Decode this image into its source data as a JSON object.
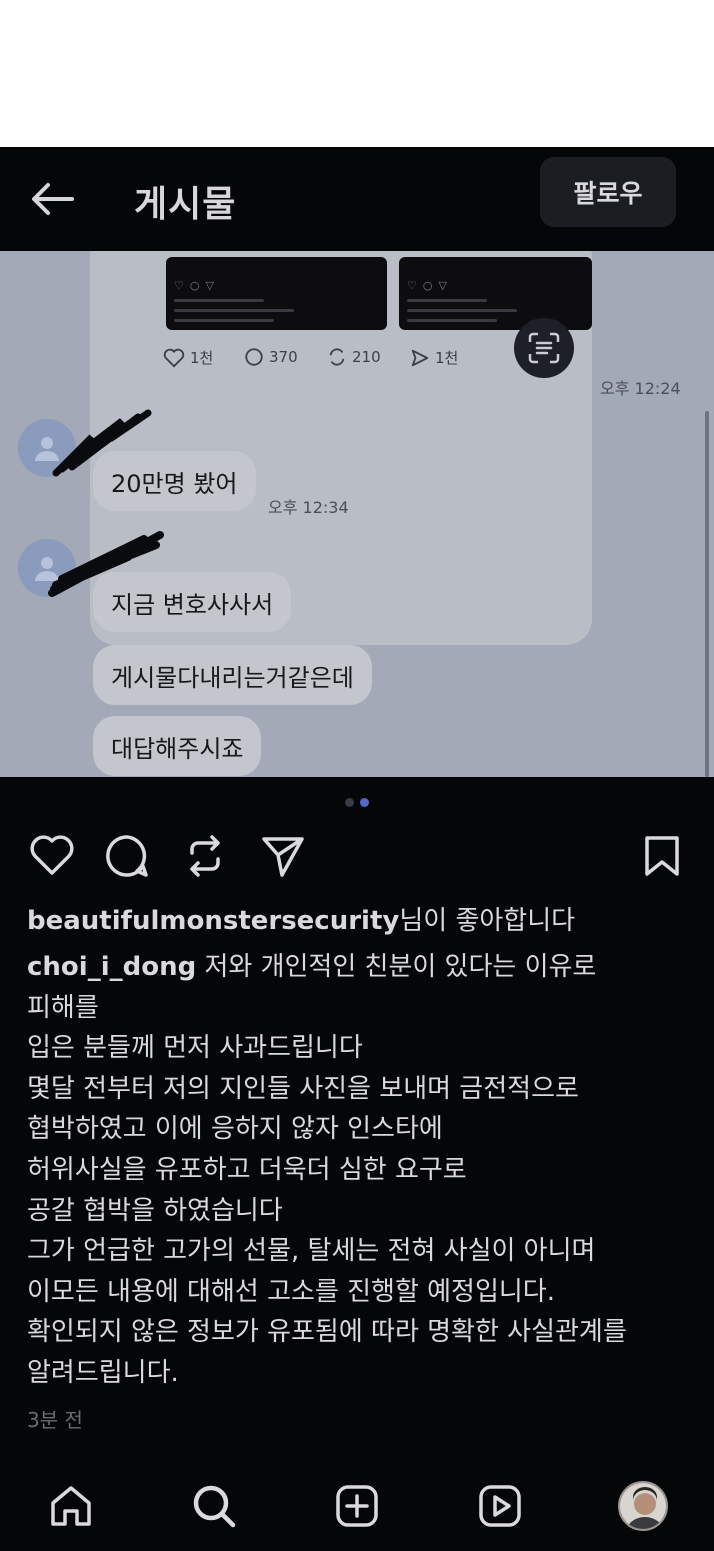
{
  "header": {
    "title": "게시물",
    "follow_label": "팔로우"
  },
  "media": {
    "stats": {
      "likes": "1천",
      "comments": "370",
      "reposts": "210",
      "shares": "1천"
    },
    "time_1": "오후 12:24",
    "time_2": "오후 12:34",
    "bubbles": [
      "20만명 봤어",
      "지금 변호사사서",
      "게시물다내리는거같은데",
      "대답해주시죠"
    ]
  },
  "carousel": {
    "count": 2,
    "active": 2
  },
  "post": {
    "liked_by_user": "beautifulmonstersecurity",
    "liked_by_suffix": "님이 좋아합니다",
    "author": "choi_i_dong",
    "caption_first": " 저와 개인적인 친분이 있다는 이유로",
    "caption_lines": [
      "피해를",
      "입은 분들께 먼저 사과드립니다",
      "몇달 전부터 저의 지인들 사진을 보내며 금전적으로",
      "협박하였고 이에 응하지 않자 인스타에",
      "허위사실을 유포하고 더욱더 심한 요구로",
      "공갈 협박을 하였습니다",
      "그가 언급한 고가의 선물, 탈세는 전혀 사실이 아니며",
      "이모든 내용에 대해선 고소를 진행할 예정입니다.",
      "확인되지 않은 정보가 유포됨에 따라 명확한 사실관계를",
      "알려드립니다."
    ],
    "time_ago": "3분 전"
  },
  "colors": {
    "background": "#050608",
    "text": "#d9d9de",
    "muted": "#6a6c72",
    "accent": "#5468c9"
  },
  "icons": [
    "back-arrow-icon",
    "heart-icon",
    "comment-icon",
    "repost-icon",
    "share-icon",
    "bookmark-icon",
    "home-icon",
    "search-icon",
    "add-icon",
    "reels-icon",
    "profile-icon"
  ]
}
